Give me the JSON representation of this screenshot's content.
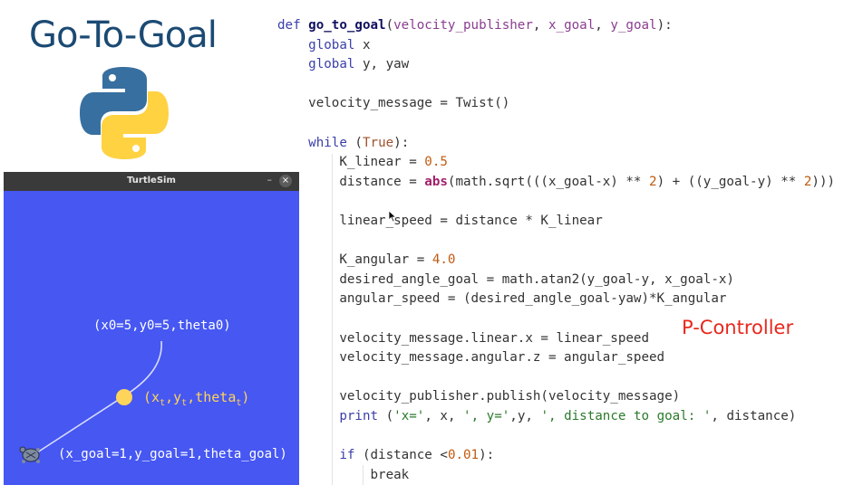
{
  "title": "Go-To-Goal",
  "logo": "python-logo",
  "turtlesim": {
    "window_title": "TurtleSim",
    "minimize_glyph": "–",
    "close_glyph": "×",
    "start_label": "(x0=5,y0=5,theta0)",
    "current_label": {
      "x": "x",
      "y": "y",
      "theta": "theta",
      "sub": "t"
    },
    "goal_label": "(x_goal=1,y_goal=1,theta_goal)",
    "colors": {
      "background": "#4657f2",
      "path": "#d8dcff",
      "current_point": "#ffd45a"
    }
  },
  "code_lines": [
    "def go_to_goal(velocity_publisher, x_goal, y_goal):",
    "    global x",
    "    global y, yaw",
    "",
    "    velocity_message = Twist()",
    "",
    "    while (True):",
    "        K_linear = 0.5",
    "        distance = abs(math.sqrt(((x_goal-x) ** 2) + ((y_goal-y) ** 2)))",
    "",
    "        linear_speed = distance * K_linear",
    "",
    "        K_angular = 4.0",
    "        desired_angle_goal = math.atan2(y_goal-y, x_goal-x)",
    "        angular_speed = (desired_angle_goal-yaw)*K_angular",
    "",
    "        velocity_message.linear.x = linear_speed",
    "        velocity_message.angular.z = angular_speed",
    "",
    "        velocity_publisher.publish(velocity_message)",
    "        print ('x=', x, ', y=',y, ', distance to goal: ', distance)",
    "",
    "        if (distance <0.01):",
    "            break"
  ],
  "annotation": "P-Controller",
  "colors": {
    "title": "#1b4a73",
    "annotation": "#e8281c"
  }
}
